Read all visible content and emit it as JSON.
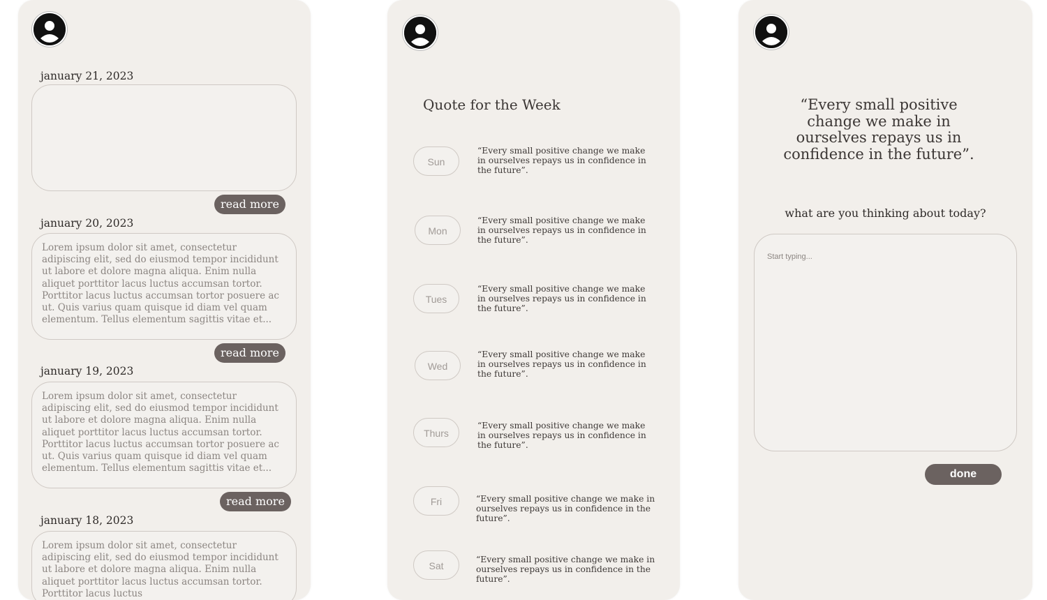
{
  "journal_list": {
    "entries": [
      {
        "date": "january 21, 2023",
        "text": "",
        "read_more": "read more"
      },
      {
        "date": "january 20, 2023",
        "text": "Lorem ipsum dolor sit amet, consectetur adipiscing elit, sed do eiusmod tempor incididunt ut labore et dolore magna aliqua. Enim nulla aliquet porttitor lacus luctus accumsan tortor. Porttitor lacus luctus accumsan tortor posuere ac ut. Quis varius quam quisque id diam vel quam elementum. Tellus elementum sagittis vitae et...",
        "read_more": "read more"
      },
      {
        "date": "january 19, 2023",
        "text": "Lorem ipsum dolor sit amet, consectetur adipiscing elit, sed do eiusmod tempor incididunt ut labore et dolore magna aliqua. Enim nulla aliquet porttitor lacus luctus accumsan tortor. Porttitor lacus luctus accumsan tortor posuere ac ut. Quis varius quam quisque id diam vel quam elementum. Tellus elementum sagittis vitae et...",
        "read_more": "read more"
      },
      {
        "date": "january 18, 2023",
        "text": "Lorem ipsum dolor sit amet, consectetur adipiscing elit, sed do eiusmod tempor incididunt ut labore et dolore magna aliqua. Enim nulla aliquet porttitor lacus luctus accumsan tortor. Porttitor lacus luctus"
      }
    ]
  },
  "weekly_quotes": {
    "title": "Quote for the Week",
    "days": [
      {
        "day": "Sun",
        "quote": "“Every small positive change we make in ourselves repays us in confidence in the future”."
      },
      {
        "day": "Mon",
        "quote": "“Every small positive change we make in ourselves repays us in confidence in the future”."
      },
      {
        "day": "Tues",
        "quote": "“Every small positive change we make in ourselves repays us in confidence in the future”."
      },
      {
        "day": "Wed",
        "quote": "“Every small positive change we make in ourselves repays us in confidence in the future”."
      },
      {
        "day": "Thurs",
        "quote": "“Every small positive change we make in ourselves repays us in confidence in the future”."
      },
      {
        "day": "Fri",
        "quote": "“Every small positive change we make in ourselves repays us in confidence in the future”."
      },
      {
        "day": "Sat",
        "quote": "“Every small positive change we make in ourselves repays us in confidence in the future”."
      }
    ]
  },
  "journal_compose": {
    "quote": "“Every small positive change we make in ourselves repays us in confidence in the future”.",
    "prompt": "what are you thinking about today?",
    "input_placeholder": "Start typing...",
    "done_label": "done"
  },
  "icons": {
    "avatar": "user-avatar-icon"
  },
  "colors": {
    "panel_bg": "#f2efeb",
    "button_bg": "#6b6260",
    "border": "#cfc9c4"
  }
}
